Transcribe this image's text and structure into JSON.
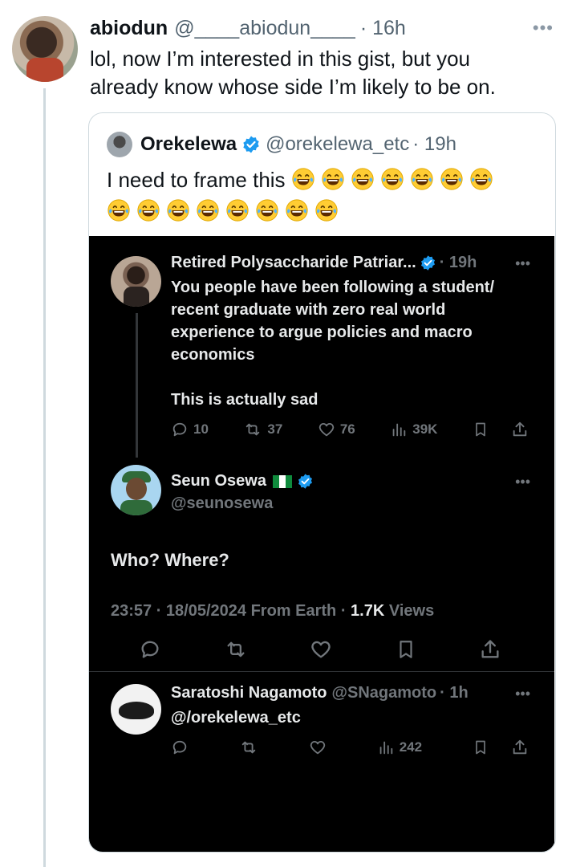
{
  "outer_tweet": {
    "name": "abiodun",
    "handle": "@____abiodun____",
    "time": "· 16h",
    "text": "lol, now I’m interested in this gist, but you already know whose side I’m likely to be on."
  },
  "quote": {
    "name": "Orekelewa",
    "handle": "@orekelewa_etc",
    "time": "· 19h",
    "text": "I need to frame this",
    "emoji_count_line1": 7,
    "emoji_count_line2": 8
  },
  "embedded": {
    "reply1": {
      "name": "Retired Polysaccharide Patriar...",
      "time": "· 19h",
      "text_line1": "You people have been following a student/",
      "text_line2": "recent graduate with zero real world",
      "text_line3": "experience to argue policies and macro",
      "text_line4": "economics",
      "text_line5": "This is actually sad",
      "replies": "10",
      "reposts": "37",
      "likes": "76",
      "views": "39K"
    },
    "main": {
      "name": "Seun Osewa",
      "handle": "@seunosewa",
      "text": "Who? Where?",
      "timestamp": "23:57 · 18/05/2024 From Earth · ",
      "views_count": "1.7K",
      "views_label": " Views"
    },
    "reply2": {
      "name": "Saratoshi Nagamoto",
      "handle": "@SNagamoto",
      "time": "· 1h",
      "text": "@/orekelewa_etc",
      "views": "242"
    }
  },
  "colors": {
    "verified_blue": "#1d9bf0",
    "dark_bg": "#000000",
    "muted": "#71767b"
  }
}
